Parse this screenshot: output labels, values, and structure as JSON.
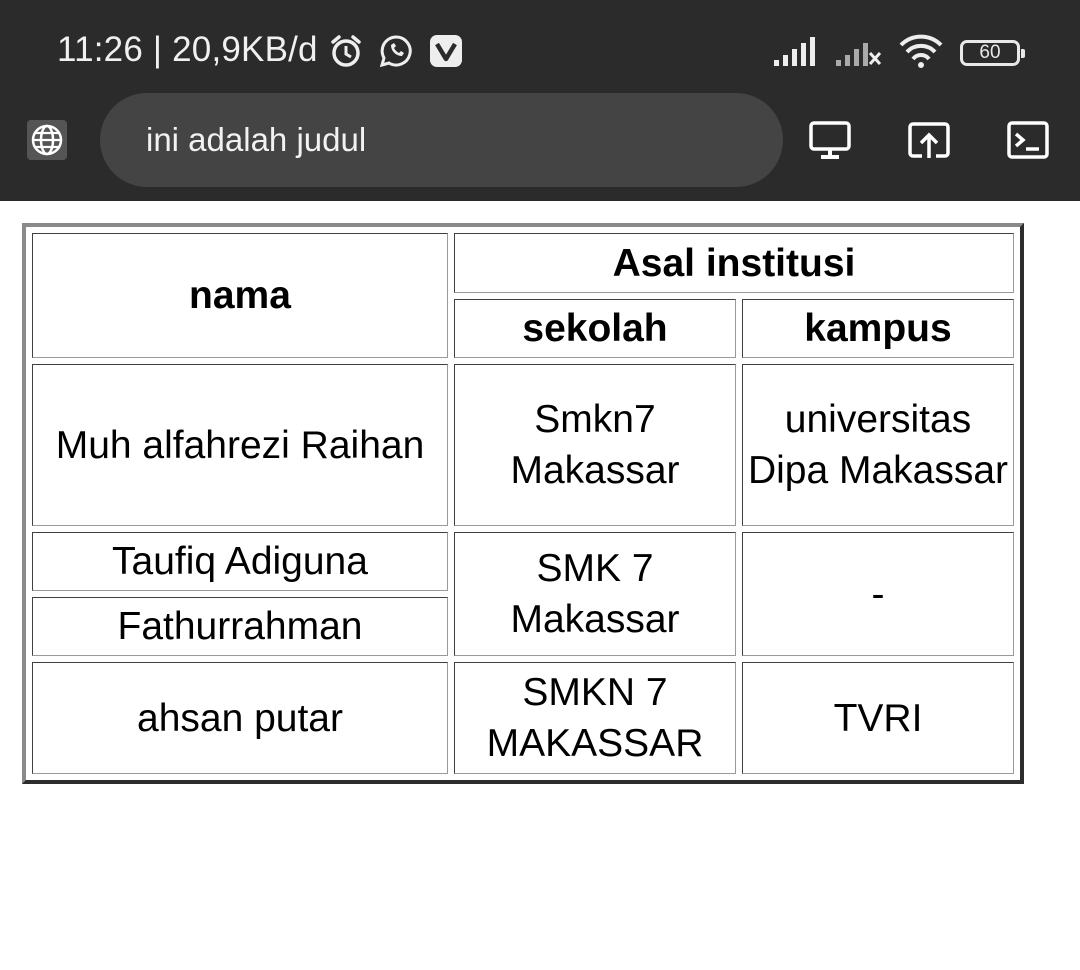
{
  "status_bar": {
    "time_speed": "11:26 | 20,9KB/d",
    "battery": "60",
    "left_icons": [
      "alarm-icon",
      "whatsapp-icon",
      "vivaldi-icon"
    ],
    "right_icons": [
      "signal-icon",
      "signal-no-sim-icon",
      "wifi-icon",
      "battery-icon"
    ]
  },
  "browser": {
    "url": "ini adalah judul",
    "buttons": [
      "desktop-icon",
      "share-icon",
      "terminal-icon"
    ]
  },
  "table": {
    "header": {
      "nama": "nama",
      "asal": "Asal institusi",
      "sekolah": "sekolah",
      "kampus": "kampus"
    },
    "rows": [
      {
        "nama": "Muh alfahrezi Raihan",
        "sekolah": "Smkn7 Makassar",
        "kampus": "universitas Dipa Makassar"
      },
      {
        "nama_a": "Taufiq Adiguna",
        "nama_b": "Fathurrahman",
        "sekolah": "SMK 7 Makassar",
        "kampus": "-"
      },
      {
        "nama": "ahsan putar",
        "sekolah": "SMKN 7 MAKASSAR",
        "kampus": "TVRI"
      }
    ]
  },
  "colors": {
    "topbar": "#2b2b2b",
    "urlbar": "#444444",
    "page": "#ffffff"
  }
}
